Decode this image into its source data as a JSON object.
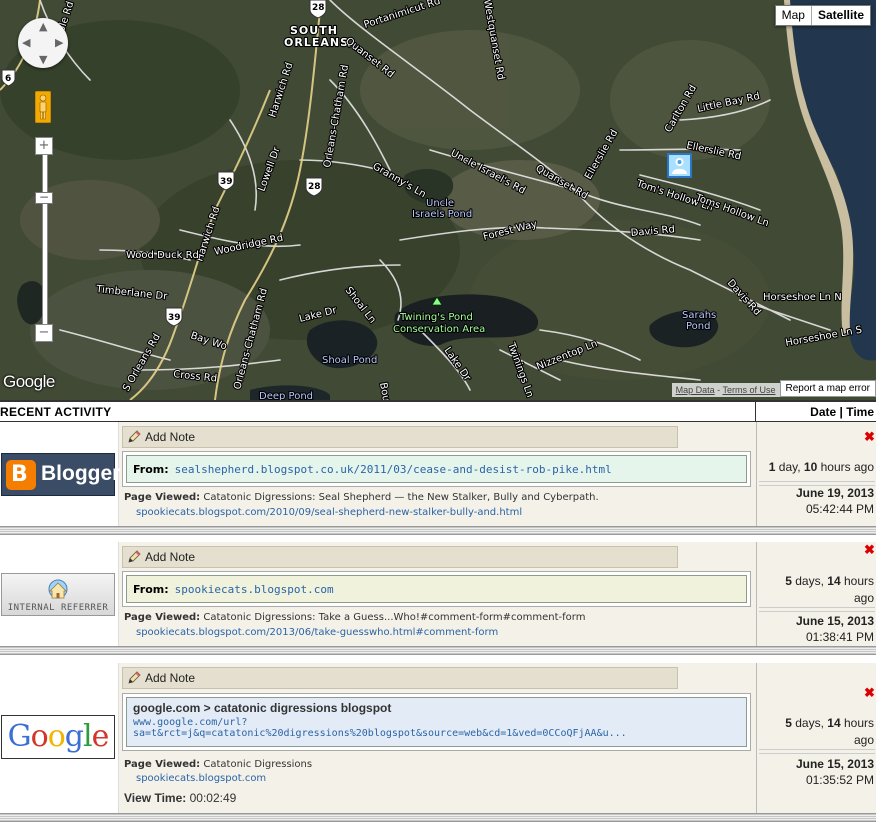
{
  "map": {
    "maptype_map": "Map",
    "maptype_satellite": "Satellite",
    "google_logo": "Google",
    "map_data": "Map Data",
    "terms": "Terms of Use",
    "report": "Report a map error",
    "labels": {
      "south": "SOUTH",
      "orleans": "ORLEANS",
      "uncle": "Uncle",
      "israels_pond": "Israels Pond",
      "twinings1": "Twining's Pond",
      "twinings2": "Conservation Area",
      "shoal_pond": "Shoal Pond",
      "sarahs": "Sarahs",
      "pond": "Pond",
      "deep_pond": "Deep Pond",
      "portanimicut": "Portanimicut Rd",
      "quanset": "Quanset Rd",
      "quanset2": "Quanset Rd",
      "uncle_israels_rd": "Uncle Israel's Rd",
      "grannys": "Granny's Ln",
      "forest": "Forest Way",
      "davis": "Davis Rd",
      "davis2": "Davis Rd",
      "toms1": "Tom's Hollow Ln",
      "toms2": "Toms Hollow Ln",
      "horseshoe1": "Horseshoe Ln N",
      "horseshoe2": "Horseshoe Ln S",
      "ellerslie": "Ellerslie Rd",
      "ellerslie2": "Ellerslie Rd",
      "little_bay": "Little Bay Rd",
      "carlton": "Carlton Rd",
      "harwich": "Harwich Rd",
      "harwich2": "Harwich Rd",
      "orleans_chatham": "Orleans-Chatham Rd",
      "orleans_chatham2": "Orleans-Chatham Rd",
      "lowell": "Lowell Dr",
      "wood_duck": "Wood Duck Rd",
      "woodridge": "Woodridge Rd",
      "timberlane": "Timberlane Dr",
      "bay_woods": "Bay Wo",
      "cross": "Cross Rd",
      "s_orleans": "S Orleans Rd",
      "lake_dr": "Lake Dr",
      "lake_dr2": "Lake Dr",
      "shoal_ln": "Shoal Ln",
      "twinings_ln": "Twinings Ln",
      "nizzentop": "Nizzentop Ln",
      "bould": "Boul",
      "westquanset": "Westquanset Rd",
      "pole": "Pole Rd",
      "route28": "28",
      "route28b": "28",
      "route39": "39",
      "route39b": "39",
      "route6": "6"
    }
  },
  "header": {
    "left": "RECENT ACTIVITY",
    "right": "Date | Time"
  },
  "entries": [
    {
      "logo_text": "Blogger",
      "add_note": "Add Note",
      "from_label": "From:",
      "from_url": "sealshepherd.blogspot.co.uk/2011/03/cease-and-desist-rob-pike.html",
      "page_viewed_label": "Page Viewed:",
      "page_viewed_title": "Catatonic Digressions: Seal Shepherd — the New Stalker, Bully and Cyberpath.",
      "page_viewed_url": "spookiecats.blogspot.com/2010/09/seal-shepherd-new-stalker-bully-and.html",
      "ago_days": "1",
      "ago_days_unit": "day,",
      "ago_hours": "10",
      "ago_hours_unit": "hours ago",
      "date": "June 19, 2013",
      "time": "05:42:44 PM"
    },
    {
      "logo_text": "INTERNAL REFERRER",
      "add_note": "Add Note",
      "from_label": "From:",
      "from_url": "spookiecats.blogspot.com",
      "page_viewed_label": "Page Viewed:",
      "page_viewed_title": "Catatonic Digressions: Take a Guess...Who!#comment-form#comment-form",
      "page_viewed_url": "spookiecats.blogspot.com/2013/06/take-guesswho.html#comment-form",
      "ago_days": "5",
      "ago_days_unit": "days,",
      "ago_hours": "14",
      "ago_hours_unit": "hours",
      "ago_tail": "ago",
      "date": "June 15, 2013",
      "time": "01:38:41 PM"
    },
    {
      "logo_text": "Google",
      "add_note": "Add Note",
      "search_title": "google.com > catatonic digressions blogspot",
      "search_url1": "www.google.com/url?",
      "search_url2": "sa=t&rct=j&q=catatonic%20digressions%20blogspot&source=web&cd=1&ved=0CCoQFjAA&u...",
      "page_viewed_label": "Page Viewed:",
      "page_viewed_title": "Catatonic Digressions",
      "page_viewed_url": "spookiecats.blogspot.com",
      "view_time_label": "View Time:",
      "view_time": "00:02:49",
      "ago_days": "5",
      "ago_days_unit": "days,",
      "ago_hours": "14",
      "ago_hours_unit": "hours",
      "ago_tail": "ago",
      "date": "June 15, 2013",
      "time": "01:35:52 PM"
    }
  ],
  "colors": {
    "link": "#2a64a8",
    "note_bar": "#e4dfcf",
    "from_green": "#e6f5ec",
    "from_khaki": "#f0f2dc",
    "search_blue": "#e3ecf6",
    "delete_red": "#dd0000"
  },
  "icons": [
    "pencil-icon",
    "delete-x-icon",
    "blogger-logo",
    "internal-referrer-logo",
    "google-logo",
    "pegman-icon",
    "pan-control-icon"
  ]
}
